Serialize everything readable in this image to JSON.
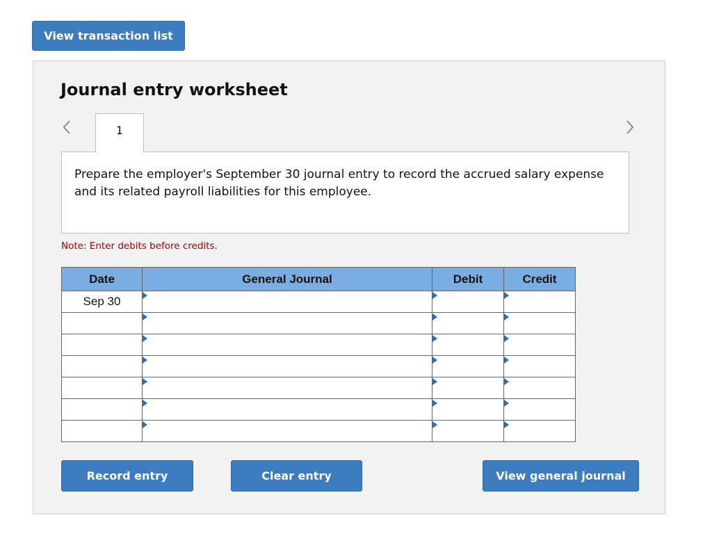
{
  "top_button": {
    "label": "View transaction list"
  },
  "worksheet": {
    "title": "Journal entry worksheet",
    "active_tab": "1",
    "instruction": "Prepare the employer's September 30 journal entry to record the accrued salary expense and its related payroll liabilities for this employee.",
    "note": "Note: Enter debits before credits."
  },
  "table": {
    "headers": {
      "date": "Date",
      "general_journal": "General Journal",
      "debit": "Debit",
      "credit": "Credit"
    },
    "rows": [
      {
        "date": "Sep 30",
        "account": "",
        "debit": "",
        "credit": ""
      },
      {
        "date": "",
        "account": "",
        "debit": "",
        "credit": ""
      },
      {
        "date": "",
        "account": "",
        "debit": "",
        "credit": ""
      },
      {
        "date": "",
        "account": "",
        "debit": "",
        "credit": ""
      },
      {
        "date": "",
        "account": "",
        "debit": "",
        "credit": ""
      },
      {
        "date": "",
        "account": "",
        "debit": "",
        "credit": ""
      },
      {
        "date": "",
        "account": "",
        "debit": "",
        "credit": ""
      }
    ]
  },
  "actions": {
    "record": "Record entry",
    "clear": "Clear entry",
    "view_general_journal": "View general journal"
  },
  "icons": {
    "prev": "chevron-left-icon",
    "next": "chevron-right-icon",
    "cell_marker": "triangle-right-icon"
  },
  "colors": {
    "button": "#3e7cc0",
    "header": "#7aaee3",
    "note": "#a30000",
    "panel": "#f2f2f2"
  }
}
